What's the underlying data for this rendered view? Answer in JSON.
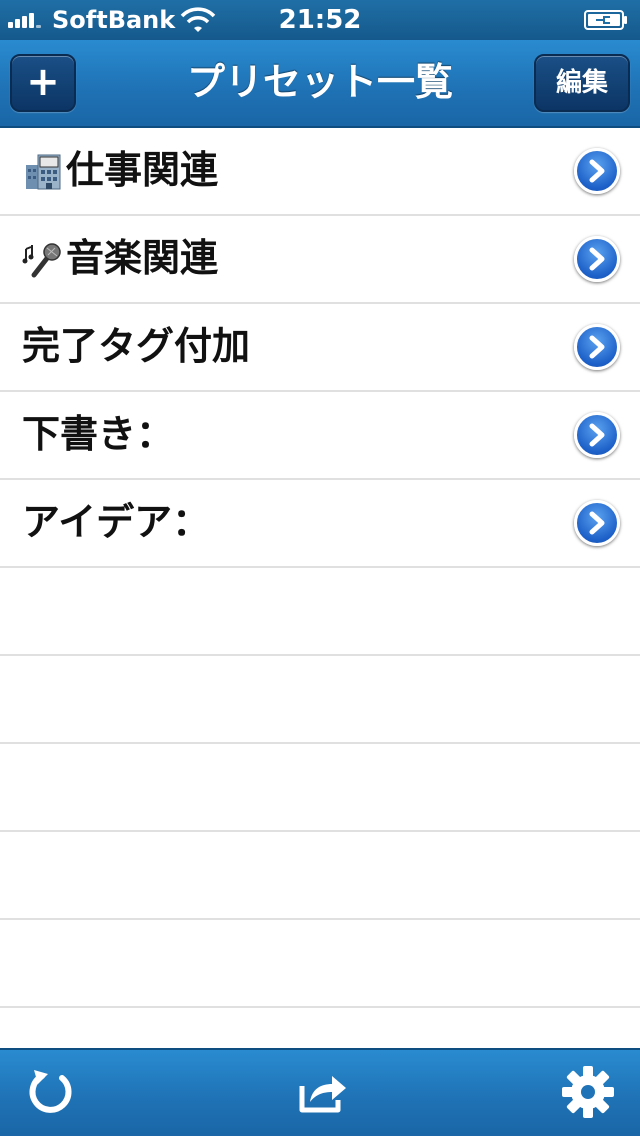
{
  "status_bar": {
    "carrier": "SoftBank",
    "time": "21:52",
    "icons": [
      "signal-icon",
      "wifi-icon",
      "battery-charging-icon"
    ]
  },
  "nav_bar": {
    "title": "プリセット一覧",
    "add_label": "+",
    "edit_label": "編集"
  },
  "list": {
    "items": [
      {
        "label": "仕事関連",
        "icon": "office-building-icon"
      },
      {
        "label": "音楽関連",
        "icon": "microphone-icon"
      },
      {
        "label": "完了タグ付加",
        "icon": ""
      },
      {
        "label": "下書き：",
        "icon": ""
      },
      {
        "label": "アイデア：",
        "icon": ""
      }
    ],
    "empty_rows": 5
  },
  "toolbar": {
    "icons": [
      "refresh-icon",
      "share-icon",
      "gear-icon"
    ]
  },
  "colors": {
    "bar_blue": "#1f73b6",
    "bar_dark": "#0e4d80",
    "disclosure_blue": "#1d60c8",
    "separator": "#e0e0e0"
  }
}
